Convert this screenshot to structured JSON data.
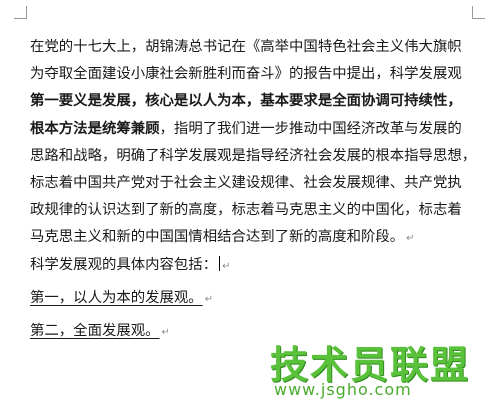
{
  "document": {
    "lines": [
      {
        "text": "在党的十七大上，胡锦涛总书记在《高举中国特色社会主义伟大旗帜"
      },
      {
        "text": "为夺取全面建设小康社会新胜利而奋斗》的报告中提出，科学发展观"
      },
      {
        "text": "第一要义是发展，核心是以人为本，基本要求是全面协调可持续性，"
      },
      {
        "bold": "根本方法是统筹兼顾",
        "text": "，指明了我们进一步推动中国经济改革与发展的"
      },
      {
        "text": "思路和战略，明确了科学发展观是指导经济社会发展的根本指导思想，"
      },
      {
        "text": "标志着中国共产党对于社会主义建设规律、社会发展规律、共产党执"
      },
      {
        "text": "政规律的认识达到了新的高度，标志着马克思主义的中国化，标志着"
      },
      {
        "text": "马克思主义和新的中国国情相结合达到了新的高度和阶段。"
      },
      {
        "text": "科学发展观的具体内容包括："
      },
      {
        "text": "第一，以人为本的发展观。"
      },
      {
        "text": "第二，全面发展观。"
      }
    ]
  },
  "watermark": {
    "title": "技术员联盟",
    "url": "www.jsgho.com",
    "color": "#5ac23a"
  }
}
